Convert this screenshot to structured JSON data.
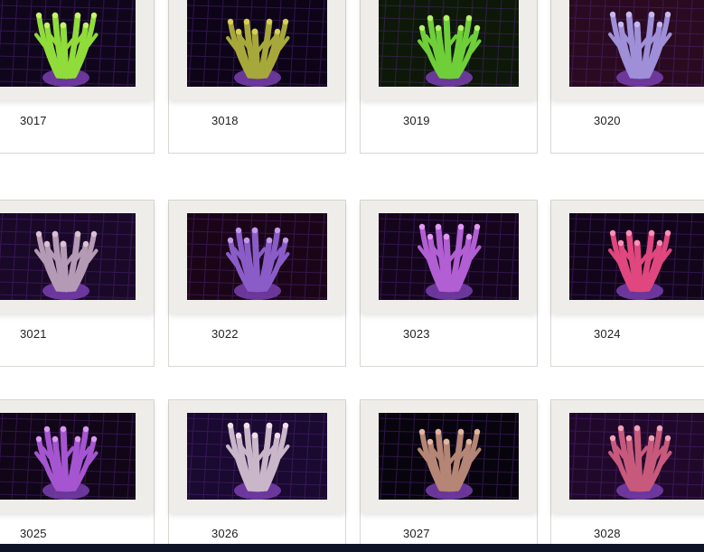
{
  "gallery": {
    "items": [
      {
        "label": "3017",
        "coral_color": "#8fdc3a",
        "tip_color": "#c8f36a",
        "bg_color": "#10061c"
      },
      {
        "label": "3018",
        "coral_color": "#a7a83a",
        "tip_color": "#d7cf58",
        "bg_color": "#0d0418"
      },
      {
        "label": "3019",
        "coral_color": "#6fcf39",
        "tip_color": "#b6ee6b",
        "bg_color": "#0d1808"
      },
      {
        "label": "3020",
        "coral_color": "#9e8fd8",
        "tip_color": "#c7b8ef",
        "bg_color": "#2a0a20"
      },
      {
        "label": "3021",
        "coral_color": "#b49ab5",
        "tip_color": "#dcc2d0",
        "bg_color": "#1a0828"
      },
      {
        "label": "3022",
        "coral_color": "#8a5cc8",
        "tip_color": "#c29ae6",
        "bg_color": "#1a0518"
      },
      {
        "label": "3023",
        "coral_color": "#b25fd3",
        "tip_color": "#e09af0",
        "bg_color": "#14051c"
      },
      {
        "label": "3024",
        "coral_color": "#e0477e",
        "tip_color": "#ff8fb8",
        "bg_color": "#12051a"
      },
      {
        "label": "3025",
        "coral_color": "#a455cf",
        "tip_color": "#d79af0",
        "bg_color": "#110518"
      },
      {
        "label": "3026",
        "coral_color": "#c9b6c9",
        "tip_color": "#efe0ea",
        "bg_color": "#1a0930"
      },
      {
        "label": "3027",
        "coral_color": "#b58575",
        "tip_color": "#e0b6a0",
        "bg_color": "#08040e"
      },
      {
        "label": "3028",
        "coral_color": "#c75a7c",
        "tip_color": "#f0a0b8",
        "bg_color": "#20082a"
      }
    ]
  }
}
